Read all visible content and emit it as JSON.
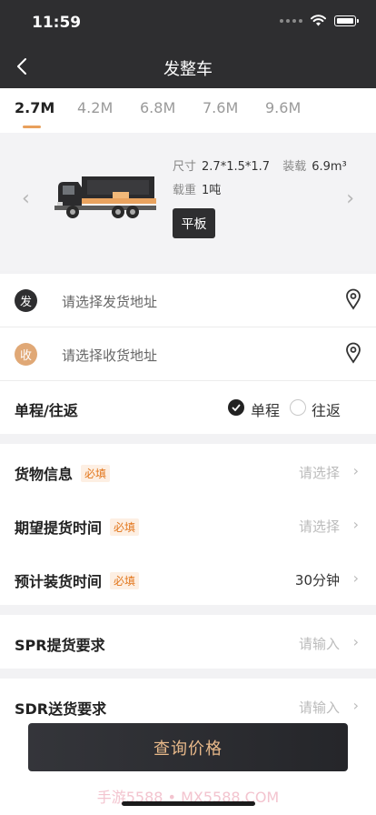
{
  "status_bar": {
    "time": "11:59"
  },
  "nav": {
    "title": "发整车"
  },
  "tabs": [
    "2.7M",
    "4.2M",
    "6.8M",
    "7.6M",
    "9.6M"
  ],
  "vehicle": {
    "size_label": "尺寸",
    "size_value": "2.7*1.5*1.7",
    "capacity_label": "装载",
    "capacity_value": "6.9m³",
    "weight_label": "载重",
    "weight_value": "1吨",
    "type": "平板"
  },
  "pickup": {
    "badge": "发",
    "placeholder": "请选择发货地址",
    "badge_color": "#2e2e30"
  },
  "delivery": {
    "badge": "收",
    "placeholder": "请选择收货地址",
    "badge_color": "#e0a876"
  },
  "trip": {
    "label": "单程/往返",
    "options": [
      "单程",
      "往返"
    ],
    "selected": "单程"
  },
  "cargo": {
    "rows": [
      {
        "label": "货物信息",
        "required": "必填",
        "value": "请选择"
      },
      {
        "label": "期望提货时间",
        "required": "必填",
        "value": "请选择"
      },
      {
        "label": "预计装货时间",
        "required": "必填",
        "value": "30分钟"
      }
    ]
  },
  "spr": {
    "label": "SPR提货要求",
    "value": "请输入"
  },
  "sdr": {
    "label": "SDR送货要求",
    "value": "请输入"
  },
  "query_button": "查询价格",
  "watermark": "手游5588 • MX5588.COM",
  "colors": {
    "accent": "#e8a05c",
    "dark": "#2e2e30"
  }
}
